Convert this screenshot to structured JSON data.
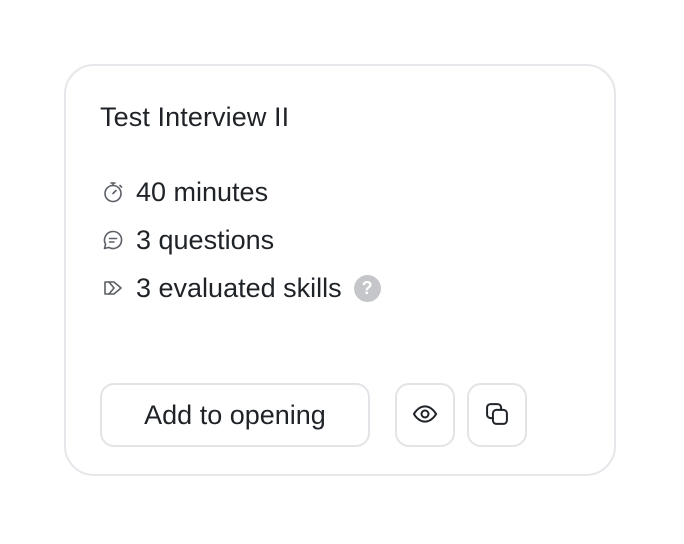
{
  "card": {
    "title": "Test Interview II",
    "meta": [
      {
        "icon": "stopwatch-icon",
        "text": "40 minutes"
      },
      {
        "icon": "chat-bubble-icon",
        "text": "3 questions"
      },
      {
        "icon": "skills-icon",
        "text": "3 evaluated skills"
      }
    ],
    "help_glyph": "?",
    "actions": {
      "add_label": "Add to opening",
      "preview_icon": "eye-icon",
      "duplicate_icon": "copy-icon"
    }
  },
  "colors": {
    "text": "#1f2328",
    "icon": "#5b5f66",
    "border": "#e6e7ea",
    "help_badge": "#c4c6ca"
  }
}
